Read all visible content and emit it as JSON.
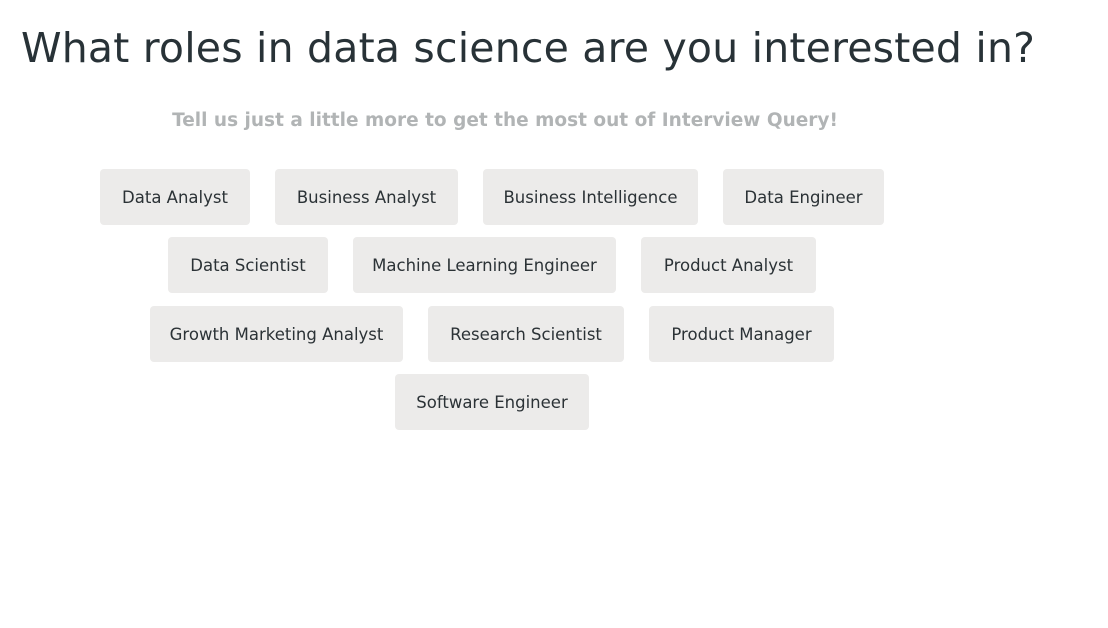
{
  "heading": {
    "title": "What roles in data science are you interested in?",
    "subtitle": "Tell us just a little more to get the most out of Interview Query!"
  },
  "roles": [
    {
      "label": "Data Analyst",
      "selected": false
    },
    {
      "label": "Business Analyst",
      "selected": false
    },
    {
      "label": "Business Intelligence",
      "selected": false
    },
    {
      "label": "Data Engineer",
      "selected": false
    },
    {
      "label": "Data Scientist",
      "selected": false
    },
    {
      "label": "Machine Learning Engineer",
      "selected": false
    },
    {
      "label": "Product Analyst",
      "selected": false
    },
    {
      "label": "Growth Marketing Analyst",
      "selected": false
    },
    {
      "label": "Research Scientist",
      "selected": false
    },
    {
      "label": "Product Manager",
      "selected": false
    },
    {
      "label": "Software Engineer",
      "selected": false
    }
  ],
  "colors": {
    "title": "#283237",
    "subtitle": "#b1b4b5",
    "chip_background": "#ecebea",
    "chip_text": "#2b3236",
    "page_background": "#ffffff"
  }
}
